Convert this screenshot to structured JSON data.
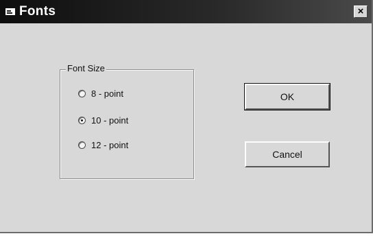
{
  "window": {
    "title": "Fonts",
    "close_glyph": "×",
    "title_icon": "window-app-icon"
  },
  "font_size_group": {
    "label": "Font Size",
    "options": [
      {
        "label": "8 - point",
        "checked": false
      },
      {
        "label": "10 - point",
        "checked": true
      },
      {
        "label": "12 - point",
        "checked": false
      }
    ]
  },
  "buttons": {
    "ok_label": "OK",
    "cancel_label": "Cancel"
  }
}
